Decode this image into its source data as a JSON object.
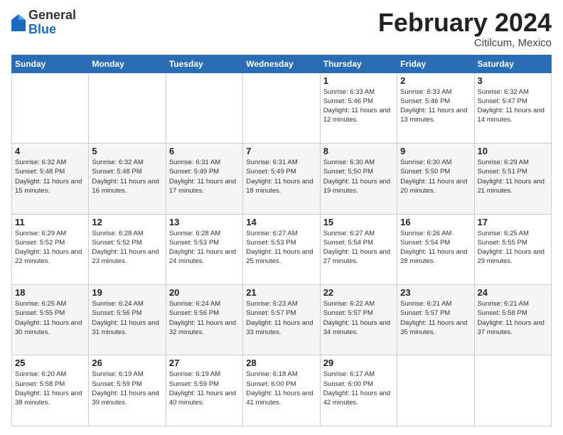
{
  "logo": {
    "general": "General",
    "blue": "Blue"
  },
  "header": {
    "month": "February 2024",
    "location": "Citilcum, Mexico"
  },
  "weekdays": [
    "Sunday",
    "Monday",
    "Tuesday",
    "Wednesday",
    "Thursday",
    "Friday",
    "Saturday"
  ],
  "weeks": [
    [
      {
        "day": "",
        "sunrise": "",
        "sunset": "",
        "daylight": ""
      },
      {
        "day": "",
        "sunrise": "",
        "sunset": "",
        "daylight": ""
      },
      {
        "day": "",
        "sunrise": "",
        "sunset": "",
        "daylight": ""
      },
      {
        "day": "",
        "sunrise": "",
        "sunset": "",
        "daylight": ""
      },
      {
        "day": "1",
        "sunrise": "Sunrise: 6:33 AM",
        "sunset": "Sunset: 5:46 PM",
        "daylight": "Daylight: 11 hours and 12 minutes."
      },
      {
        "day": "2",
        "sunrise": "Sunrise: 6:33 AM",
        "sunset": "Sunset: 5:46 PM",
        "daylight": "Daylight: 11 hours and 13 minutes."
      },
      {
        "day": "3",
        "sunrise": "Sunrise: 6:32 AM",
        "sunset": "Sunset: 5:47 PM",
        "daylight": "Daylight: 11 hours and 14 minutes."
      }
    ],
    [
      {
        "day": "4",
        "sunrise": "Sunrise: 6:32 AM",
        "sunset": "Sunset: 5:48 PM",
        "daylight": "Daylight: 11 hours and 15 minutes."
      },
      {
        "day": "5",
        "sunrise": "Sunrise: 6:32 AM",
        "sunset": "Sunset: 5:48 PM",
        "daylight": "Daylight: 11 hours and 16 minutes."
      },
      {
        "day": "6",
        "sunrise": "Sunrise: 6:31 AM",
        "sunset": "Sunset: 5:49 PM",
        "daylight": "Daylight: 11 hours and 17 minutes."
      },
      {
        "day": "7",
        "sunrise": "Sunrise: 6:31 AM",
        "sunset": "Sunset: 5:49 PM",
        "daylight": "Daylight: 11 hours and 18 minutes."
      },
      {
        "day": "8",
        "sunrise": "Sunrise: 6:30 AM",
        "sunset": "Sunset: 5:50 PM",
        "daylight": "Daylight: 11 hours and 19 minutes."
      },
      {
        "day": "9",
        "sunrise": "Sunrise: 6:30 AM",
        "sunset": "Sunset: 5:50 PM",
        "daylight": "Daylight: 11 hours and 20 minutes."
      },
      {
        "day": "10",
        "sunrise": "Sunrise: 6:29 AM",
        "sunset": "Sunset: 5:51 PM",
        "daylight": "Daylight: 11 hours and 21 minutes."
      }
    ],
    [
      {
        "day": "11",
        "sunrise": "Sunrise: 6:29 AM",
        "sunset": "Sunset: 5:52 PM",
        "daylight": "Daylight: 11 hours and 22 minutes."
      },
      {
        "day": "12",
        "sunrise": "Sunrise: 6:28 AM",
        "sunset": "Sunset: 5:52 PM",
        "daylight": "Daylight: 11 hours and 23 minutes."
      },
      {
        "day": "13",
        "sunrise": "Sunrise: 6:28 AM",
        "sunset": "Sunset: 5:53 PM",
        "daylight": "Daylight: 11 hours and 24 minutes."
      },
      {
        "day": "14",
        "sunrise": "Sunrise: 6:27 AM",
        "sunset": "Sunset: 5:53 PM",
        "daylight": "Daylight: 11 hours and 25 minutes."
      },
      {
        "day": "15",
        "sunrise": "Sunrise: 6:27 AM",
        "sunset": "Sunset: 5:54 PM",
        "daylight": "Daylight: 11 hours and 27 minutes."
      },
      {
        "day": "16",
        "sunrise": "Sunrise: 6:26 AM",
        "sunset": "Sunset: 5:54 PM",
        "daylight": "Daylight: 11 hours and 28 minutes."
      },
      {
        "day": "17",
        "sunrise": "Sunrise: 6:25 AM",
        "sunset": "Sunset: 5:55 PM",
        "daylight": "Daylight: 11 hours and 29 minutes."
      }
    ],
    [
      {
        "day": "18",
        "sunrise": "Sunrise: 6:25 AM",
        "sunset": "Sunset: 5:55 PM",
        "daylight": "Daylight: 11 hours and 30 minutes."
      },
      {
        "day": "19",
        "sunrise": "Sunrise: 6:24 AM",
        "sunset": "Sunset: 5:56 PM",
        "daylight": "Daylight: 11 hours and 31 minutes."
      },
      {
        "day": "20",
        "sunrise": "Sunrise: 6:24 AM",
        "sunset": "Sunset: 5:56 PM",
        "daylight": "Daylight: 11 hours and 32 minutes."
      },
      {
        "day": "21",
        "sunrise": "Sunrise: 6:23 AM",
        "sunset": "Sunset: 5:57 PM",
        "daylight": "Daylight: 11 hours and 33 minutes."
      },
      {
        "day": "22",
        "sunrise": "Sunrise: 6:22 AM",
        "sunset": "Sunset: 5:57 PM",
        "daylight": "Daylight: 11 hours and 34 minutes."
      },
      {
        "day": "23",
        "sunrise": "Sunrise: 6:21 AM",
        "sunset": "Sunset: 5:57 PM",
        "daylight": "Daylight: 11 hours and 35 minutes."
      },
      {
        "day": "24",
        "sunrise": "Sunrise: 6:21 AM",
        "sunset": "Sunset: 5:58 PM",
        "daylight": "Daylight: 11 hours and 37 minutes."
      }
    ],
    [
      {
        "day": "25",
        "sunrise": "Sunrise: 6:20 AM",
        "sunset": "Sunset: 5:58 PM",
        "daylight": "Daylight: 11 hours and 38 minutes."
      },
      {
        "day": "26",
        "sunrise": "Sunrise: 6:19 AM",
        "sunset": "Sunset: 5:59 PM",
        "daylight": "Daylight: 11 hours and 39 minutes."
      },
      {
        "day": "27",
        "sunrise": "Sunrise: 6:19 AM",
        "sunset": "Sunset: 5:59 PM",
        "daylight": "Daylight: 11 hours and 40 minutes."
      },
      {
        "day": "28",
        "sunrise": "Sunrise: 6:18 AM",
        "sunset": "Sunset: 6:00 PM",
        "daylight": "Daylight: 11 hours and 41 minutes."
      },
      {
        "day": "29",
        "sunrise": "Sunrise: 6:17 AM",
        "sunset": "Sunset: 6:00 PM",
        "daylight": "Daylight: 11 hours and 42 minutes."
      },
      {
        "day": "",
        "sunrise": "",
        "sunset": "",
        "daylight": ""
      },
      {
        "day": "",
        "sunrise": "",
        "sunset": "",
        "daylight": ""
      }
    ]
  ]
}
